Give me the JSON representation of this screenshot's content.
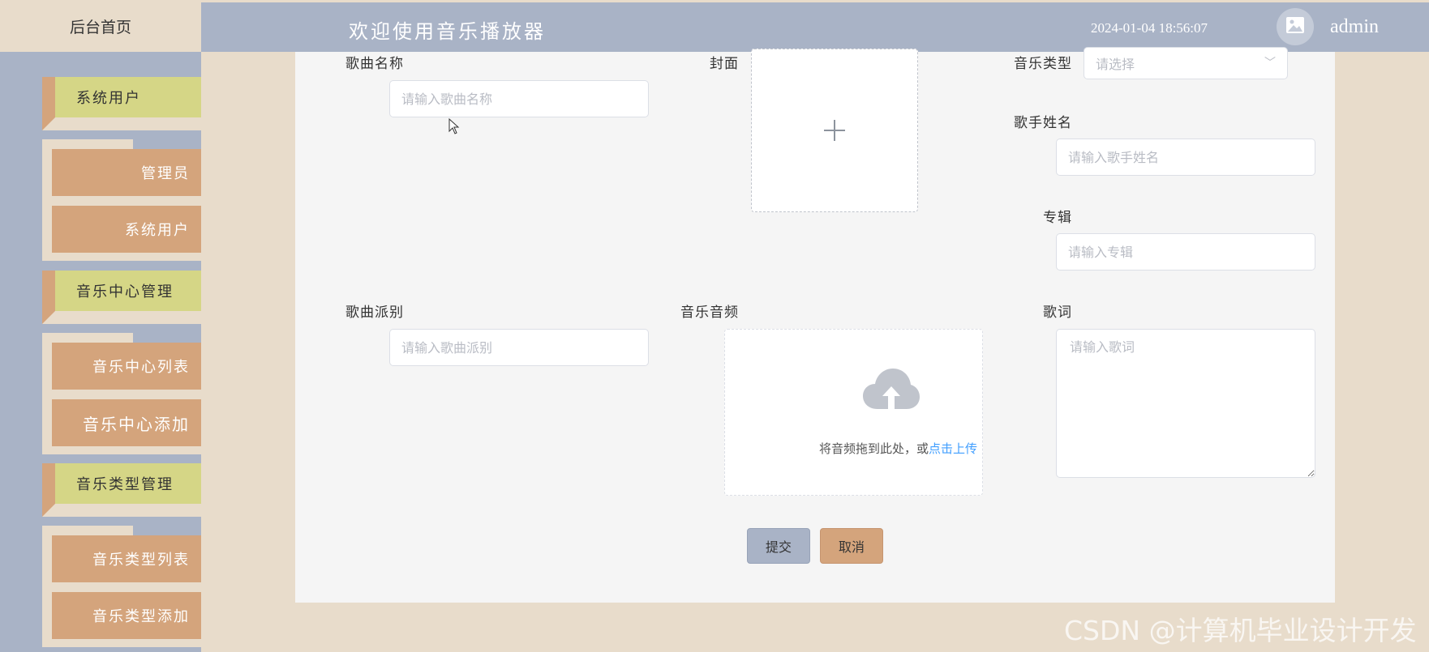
{
  "header": {
    "home_tab": "后台首页",
    "welcome": "欢迎使用音乐播放器",
    "datetime": "2024-01-04 18:56:07",
    "username": "admin",
    "avatar_icon": "image-icon"
  },
  "sidebar": {
    "groups": [
      {
        "label": "系统用户",
        "items": [
          "管理员",
          "系统用户"
        ]
      },
      {
        "label": "音乐中心管理",
        "items": [
          "音乐中心列表",
          "音乐中心添加"
        ]
      },
      {
        "label": "音乐类型管理",
        "items": [
          "音乐类型列表",
          "音乐类型添加"
        ]
      }
    ]
  },
  "form": {
    "song_name": {
      "label": "歌曲名称",
      "placeholder": "请输入歌曲名称"
    },
    "cover": {
      "label": "封面",
      "icon": "plus-icon"
    },
    "music_type": {
      "label": "音乐类型",
      "placeholder": "请选择"
    },
    "singer": {
      "label": "歌手姓名",
      "placeholder": "请输入歌手姓名"
    },
    "album": {
      "label": "专辑",
      "placeholder": "请输入专辑"
    },
    "genre": {
      "label": "歌曲派别",
      "placeholder": "请输入歌曲派别"
    },
    "audio": {
      "label": "音乐音频",
      "tip": "将音频拖到此处，或",
      "tip_link": "点击上传",
      "icon": "upload-cloud-icon"
    },
    "lyrics": {
      "label": "歌词",
      "placeholder": "请输入歌词"
    },
    "submit_label": "提交",
    "cancel_label": "取消"
  },
  "watermark": "CSDN @计算机毕业设计开发",
  "colors": {
    "header_blue": "#a9b3c6",
    "beige": "#e8dccb",
    "menu_green": "#d5d686",
    "menu_tan": "#d4a47c",
    "link_blue": "#409eff"
  }
}
